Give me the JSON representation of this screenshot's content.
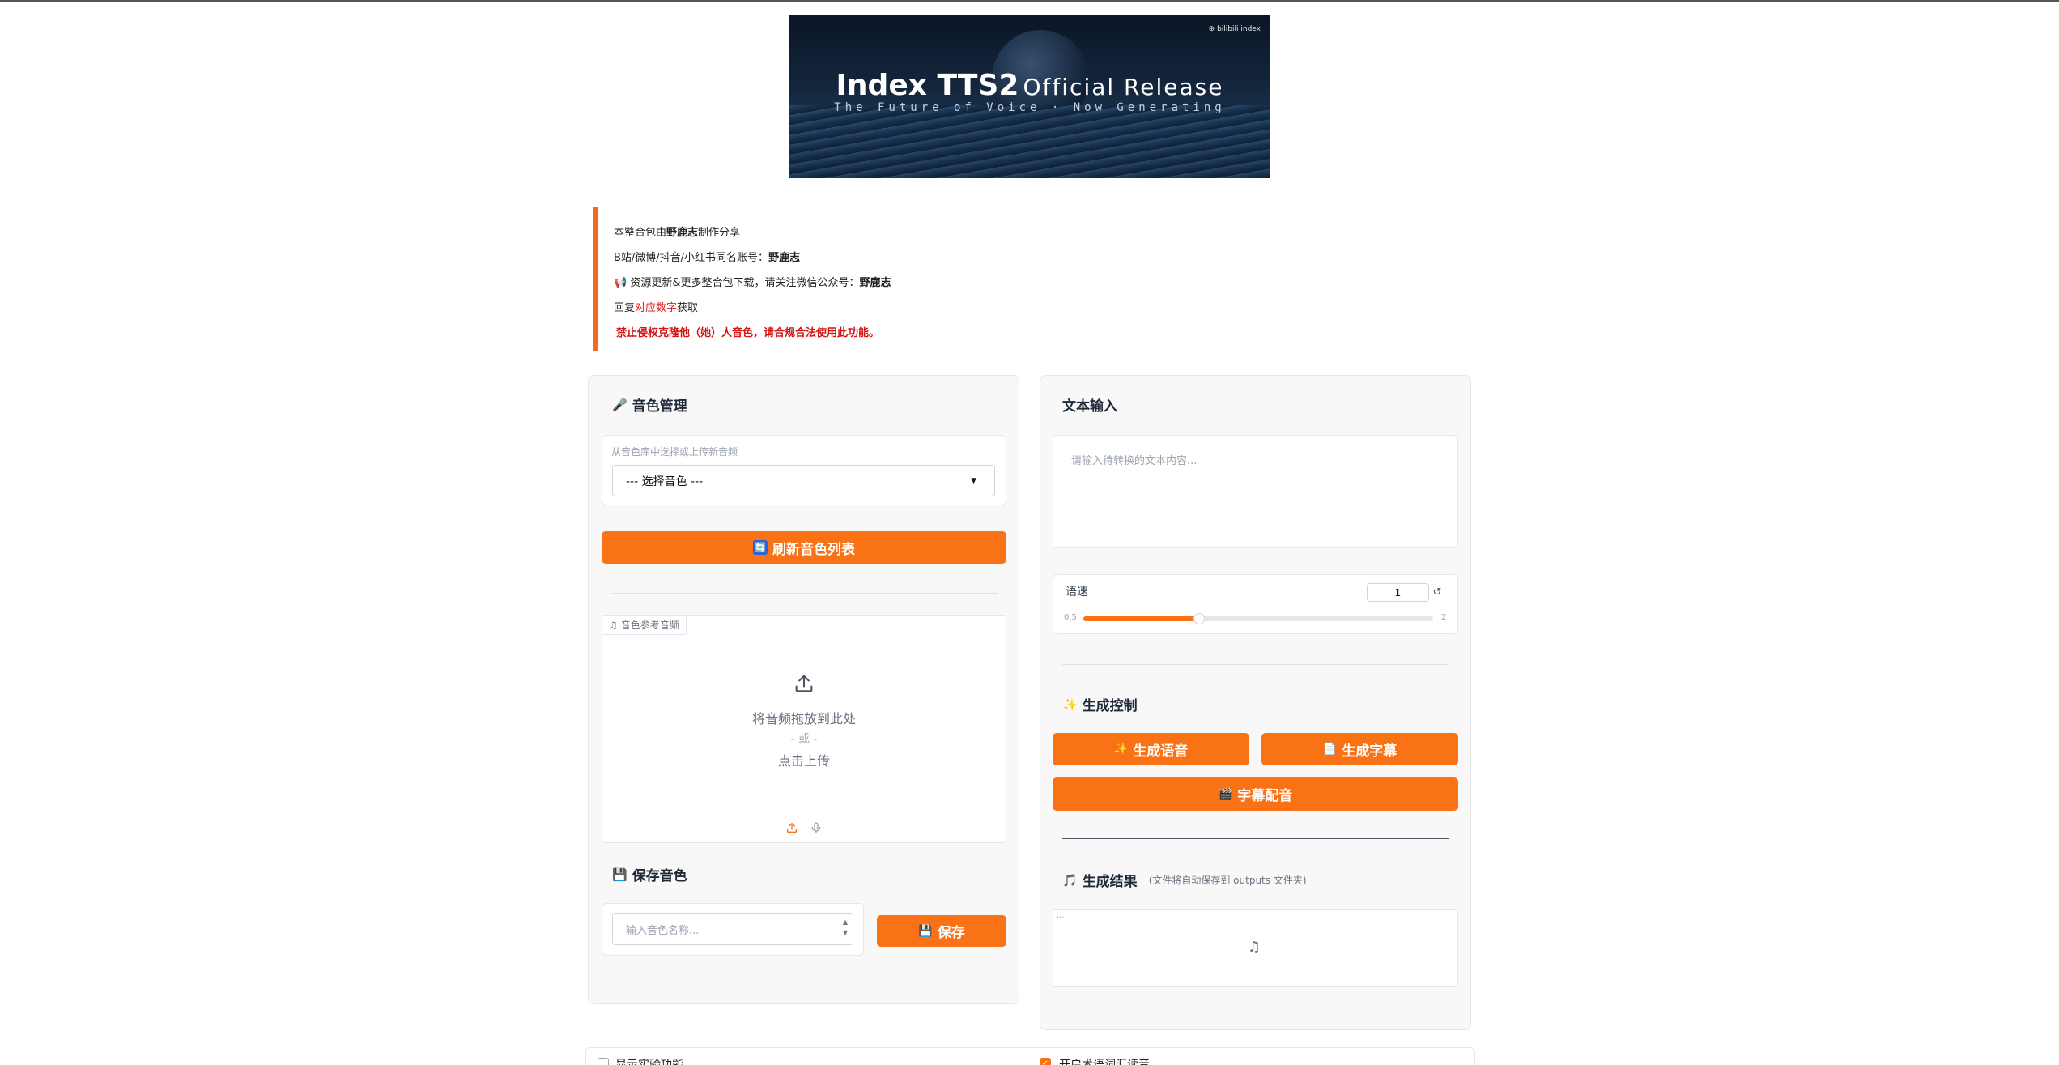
{
  "banner": {
    "logo": "⊕ bilibili index",
    "title_main": "Index TTS2",
    "title_rest": "Official Release",
    "subtitle": "The Future of Voice · Now Generating"
  },
  "notice": {
    "line1_pre": "本整合包由",
    "line1_bold": "野鹿志",
    "line1_post": "制作分享",
    "line2_pre": "B站/微博/抖音/小红书同名账号：",
    "line2_bold": "野鹿志",
    "line3_icon": "📢",
    "line3_pre": " 资源更新&更多整合包下载，请关注微信公众号：",
    "line3_bold": "野鹿志",
    "line4_pre": "回复",
    "line4_red": "对应数字",
    "line4_post": "获取",
    "line5": "禁止侵权克隆他（她）人音色，请合规合法使用此功能。"
  },
  "voice_manage": {
    "title": "音色管理",
    "icon": "🎤",
    "select_label": "从音色库中选择或上传新音频",
    "select_value": "--- 选择音色 ---",
    "refresh_label": "刷新音色列表",
    "refresh_icon": "🔄"
  },
  "upload": {
    "tag": "音色参考音频",
    "drop_text": "将音频拖放到此处",
    "or_text": "- 或 -",
    "click_text": "点击上传"
  },
  "save_voice": {
    "title": "保存音色",
    "icon": "💾",
    "name_placeholder": "输入音色名称...",
    "save_label": "保存"
  },
  "text_input": {
    "title": "文本输入",
    "placeholder": "请输入待转换的文本内容..."
  },
  "speed": {
    "label": "语速",
    "value": "1",
    "min_label": "0.5",
    "max_label": "2",
    "fraction": 0.33
  },
  "gen_control": {
    "title": "生成控制",
    "icon": "✨",
    "gen_voice_label": "生成语音",
    "gen_sub_label": "生成字幕",
    "dub_label": "字幕配音"
  },
  "gen_result": {
    "title": "生成结果",
    "icon": "🎵",
    "note": "(文件将自动保存到 outputs 文件夹)",
    "box_tag": "..."
  },
  "bottom": {
    "left_label": "显示实验功能",
    "right_label": "开启术语词汇读音"
  }
}
